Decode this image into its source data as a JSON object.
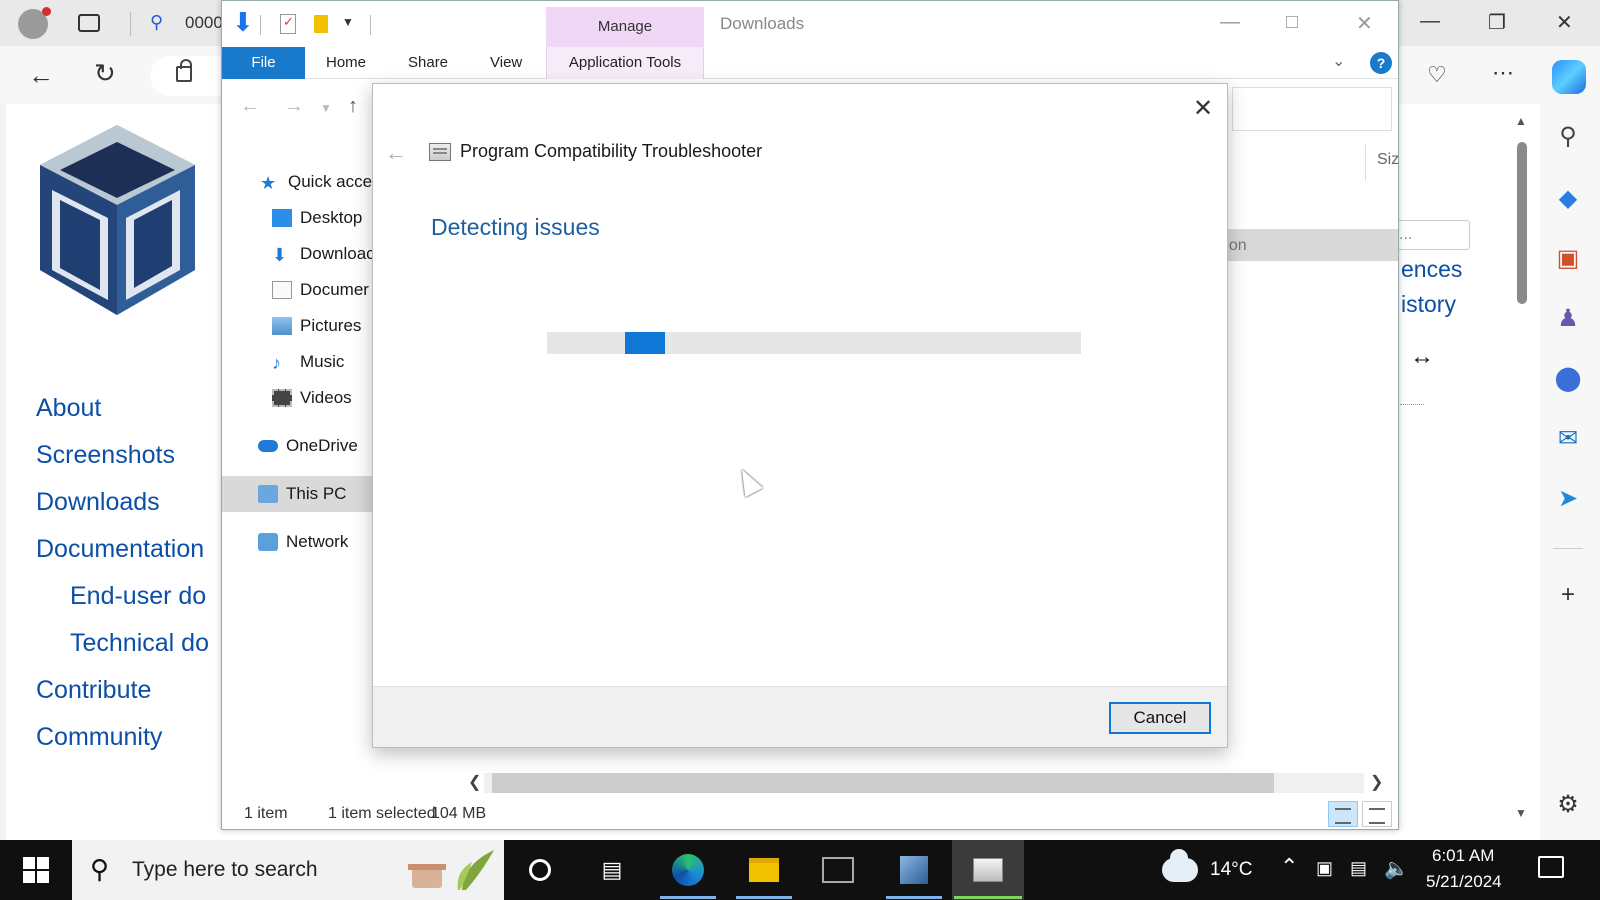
{
  "browser": {
    "tab_title": "0000",
    "colors": {
      "link": "#0b4fa8",
      "accent": "#0f78d7"
    }
  },
  "website": {
    "nav": [
      "About",
      "Screenshots",
      "Downloads",
      "Documentation",
      "End-user do",
      "Technical do",
      "Contribute",
      "Community"
    ],
    "right_links": [
      "ences",
      "istory"
    ],
    "right_search_text": "..."
  },
  "explorer": {
    "window_title": "Downloads",
    "manage_tab": "Manage",
    "ribbon_tabs": {
      "file": "File",
      "home": "Home",
      "share": "Share",
      "view": "View",
      "app_tools": "Application Tools"
    },
    "nav_pane": [
      {
        "label": "Quick acces",
        "icon": "star-icon"
      },
      {
        "label": "Desktop",
        "icon": "desktop-icon"
      },
      {
        "label": "Downloac",
        "icon": "download-icon"
      },
      {
        "label": "Documer",
        "icon": "document-icon"
      },
      {
        "label": "Pictures",
        "icon": "pictures-icon"
      },
      {
        "label": "Music",
        "icon": "music-icon"
      },
      {
        "label": "Videos",
        "icon": "videos-icon"
      },
      {
        "label": "OneDrive",
        "icon": "onedrive-icon"
      },
      {
        "label": "This PC",
        "icon": "computer-icon"
      },
      {
        "label": "Network",
        "icon": "network-icon"
      }
    ],
    "column_header": "Siz",
    "row_partial_text": "ation",
    "status": {
      "items": "1 item",
      "selected": "1 item selected",
      "size": "104 MB"
    }
  },
  "dialog": {
    "title": "Program Compatibility Troubleshooter",
    "heading": "Detecting issues",
    "cancel_label": "Cancel"
  },
  "taskbar": {
    "search_placeholder": "Type here to search",
    "temperature": "14°C",
    "time": "6:01 AM",
    "date": "5/21/2024"
  }
}
